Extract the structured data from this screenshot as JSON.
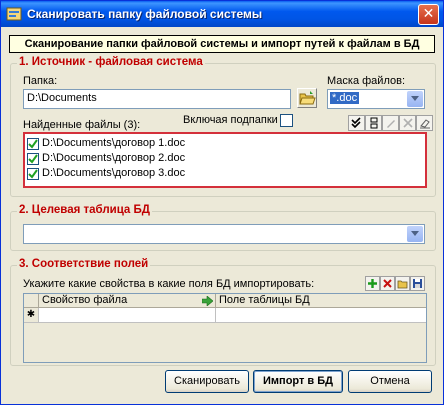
{
  "window": {
    "title": "Сканировать папку файловой системы",
    "close_glyph": "✕",
    "banner": "Сканирование папки файловой системы и импорт путей к файлам в БД"
  },
  "source": {
    "legend": "1. Источник - файловая система",
    "folder_label": "Папка:",
    "folder_value": "D:\\Documents",
    "mask_label": "Маска файлов:",
    "mask_value": "*.doc",
    "include_subfolders_label": "Включая подпапки",
    "include_subfolders_checked": false,
    "found_files_label": "Найденные файлы (3):",
    "files": [
      {
        "name": "D:\\Documents\\договор 1.doc",
        "checked": true
      },
      {
        "name": "D:\\Documents\\договор 2.doc",
        "checked": true
      },
      {
        "name": "D:\\Documents\\договор 3.doc",
        "checked": true
      }
    ],
    "toolbar_icons": [
      "check-all-icon",
      "uncheck-all-icon",
      "edit-icon",
      "delete-icon",
      "clear-icon"
    ]
  },
  "target": {
    "legend": "2. Целевая таблица БД",
    "table_value": ""
  },
  "mapping": {
    "legend": "3. Соответствие полей",
    "instruction": "Укажите какие свойства в какие поля БД импортировать:",
    "columns": [
      "Свойство файла",
      "Поле таблицы БД"
    ],
    "new_row_marker": "✱",
    "toolbar_icons": [
      "add-icon",
      "delete-icon",
      "open-icon",
      "save-icon"
    ]
  },
  "buttons": {
    "scan": "Сканировать",
    "import": "Импорт в БД",
    "cancel": "Отмена"
  },
  "colors": {
    "title_bar": "#0055e5",
    "legend_text": "#c00000",
    "files_highlight_border": "#d4303b",
    "selection": "#316ac5"
  }
}
